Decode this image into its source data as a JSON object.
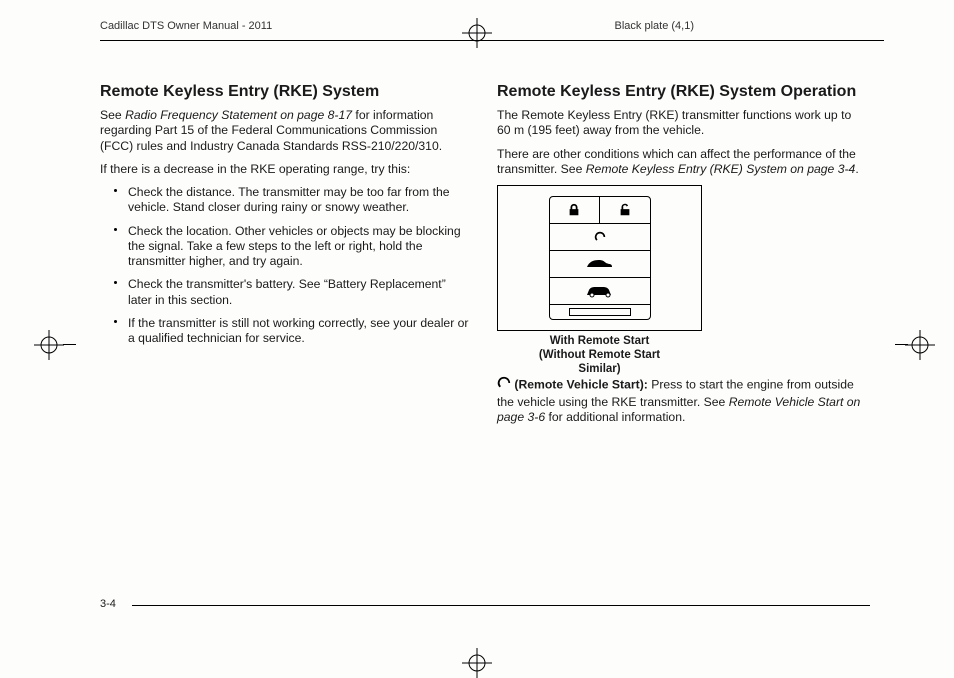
{
  "header": {
    "left": "Cadillac DTS Owner Manual - 2011",
    "right": "Black plate (4,1)"
  },
  "left_col": {
    "heading": "Remote Keyless Entry (RKE) System",
    "para1_pre": "See ",
    "para1_italic": "Radio Frequency Statement on page 8-17",
    "para1_post": " for information regarding Part 15 of the Federal Communications Commission (FCC) rules and Industry Canada Standards RSS-210/220/310.",
    "para2": "If there is a decrease in the RKE operating range, try this:",
    "bullets": [
      "Check the distance. The transmitter may be too far from the vehicle. Stand closer during rainy or snowy weather.",
      "Check the location. Other vehicles or objects may be blocking the signal. Take a few steps to the left or right, hold the transmitter higher, and try again.",
      "Check the transmitter's battery. See “Battery Replacement” later in this section.",
      "If the transmitter is still not working correctly, see your dealer or a qualified technician for service."
    ]
  },
  "right_col": {
    "heading": "Remote Keyless Entry (RKE) System Operation",
    "para1": "The Remote Keyless Entry (RKE) transmitter functions work up to 60 m (195 feet) away from the vehicle.",
    "para2_pre": "There are other conditions which can affect the performance of the transmitter. See ",
    "para2_italic": "Remote Keyless Entry (RKE) System on page 3-4",
    "para2_post": ".",
    "caption_l1": "With Remote Start",
    "caption_l2": "(Without Remote Start",
    "caption_l3": "Similar)",
    "rvs_label": " (Remote Vehicle Start):",
    "rvs_text_pre": " Press to start the engine from outside the vehicle using the RKE transmitter. See ",
    "rvs_text_italic": "Remote Vehicle Start on page 3-6",
    "rvs_text_post": " for additional information."
  },
  "footer": {
    "page_num": "3-4"
  }
}
